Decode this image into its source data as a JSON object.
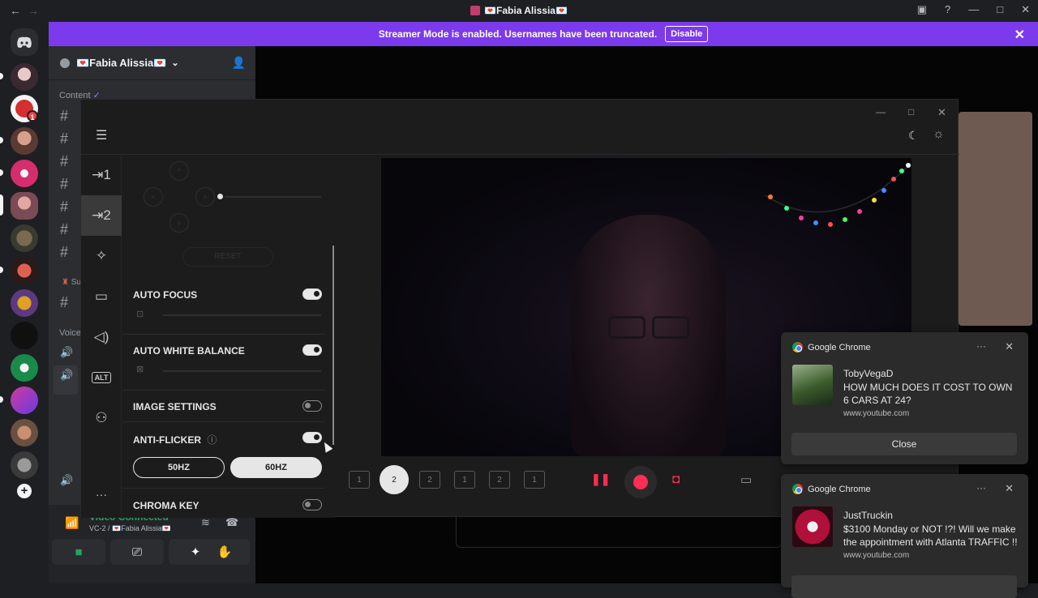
{
  "titlebar": {
    "back": "←",
    "forward": "→",
    "title": "💌Fabia Alissia💌"
  },
  "banner": {
    "text": "Streamer Mode is enabled. Usernames have been truncated.",
    "button": "Disable",
    "close": "✕"
  },
  "guilds": {
    "badge_count": "1"
  },
  "sidebar": {
    "server_name": "💌Fabia Alissia💌",
    "chevron": "⌄",
    "category": "Content",
    "category_check": "✓",
    "hash": "#",
    "sub_label": "Su",
    "voice_label": "Voice"
  },
  "voice_status": {
    "title": "Video Connected",
    "channel": "VC-2 / 💌Fabia Alissia💌"
  },
  "app": {
    "settings": {
      "reset": "RESET",
      "auto_focus": "AUTO FOCUS",
      "auto_white_balance": "AUTO WHITE BALANCE",
      "image_settings": "IMAGE SETTINGS",
      "anti_flicker": "ANTI-FLICKER",
      "hz_50": "50HZ",
      "hz_60": "60HZ",
      "chroma_key": "CHROMA KEY"
    },
    "rail": {
      "alt": "ALT",
      "more": "···"
    },
    "layouts": [
      "1",
      "2",
      "2",
      "1",
      "2",
      "1"
    ],
    "active_layout": "2"
  },
  "notifications": [
    {
      "app": "Google Chrome",
      "title": "TobyVegaD",
      "body": "HOW MUCH DOES IT COST TO OWN 6 CARS AT 24?",
      "source": "www.youtube.com",
      "button": "Close"
    },
    {
      "app": "Google Chrome",
      "title": "JustTruckin",
      "body": "$3100 Monday or NOT !?! Will we make the appointment with Atlanta TRAFFIC !!",
      "source": "www.youtube.com"
    }
  ],
  "colors": {
    "streamer_banner": "#7c3aed",
    "voice_connected": "#23a55a",
    "record": "#ff2d55"
  }
}
